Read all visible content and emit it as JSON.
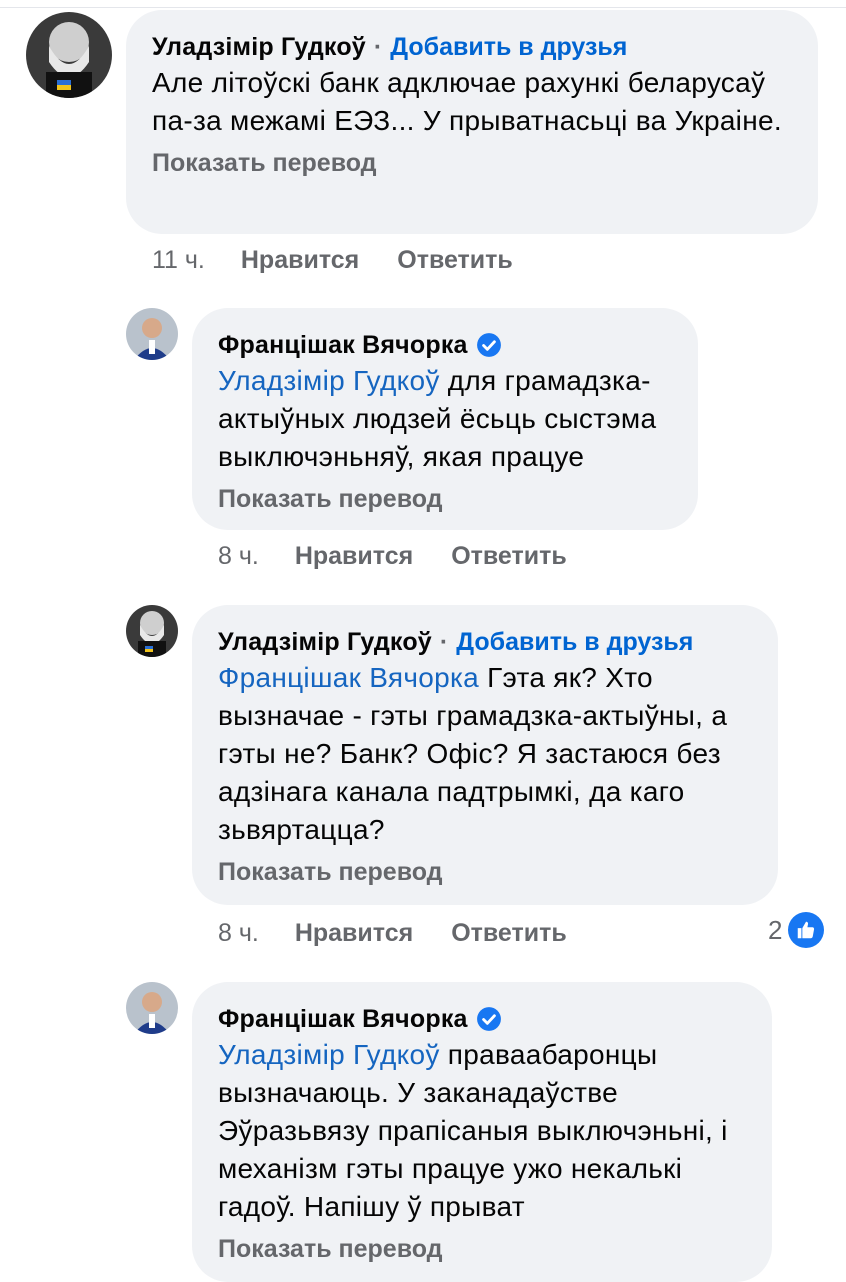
{
  "colors": {
    "bubble_bg": "#f0f2f5",
    "link_blue": "#0064d1",
    "mention_blue": "#1565c0",
    "meta_gray": "#65676b",
    "like_blue": "#1877f2"
  },
  "comments": [
    {
      "author": "Уладзімір Гудкоў",
      "separator": "·",
      "add_friend": "Добавить в друзья",
      "mention": "",
      "text": "Але літоўскі банк адключае рахункі беларусаў па-за межамі ЕЭЗ... У прыватнасьці ва Украіне.",
      "show_translation": "Показать перевод",
      "time": "11 ч.",
      "like": "Нравится",
      "reply": "Ответить"
    },
    {
      "author": "Францішак Вячорка",
      "verified_icon": "verified-badge-icon",
      "mention": "Уладзімір Гудкоў",
      "text": " для грамадзка-актыўных людзей ёсьць сыстэма выключэньняў, якая працуе",
      "show_translation": "Показать перевод",
      "time": "8 ч.",
      "like": "Нравится",
      "reply": "Ответить"
    },
    {
      "author": "Уладзімір Гудкоў",
      "separator": "·",
      "add_friend": "Добавить в друзья",
      "mention": "Францішак Вячорка",
      "text": " Гэта як? Хто вызначае - гэты грамадзка-актыўны, а гэты не? Банк? Офіс? Я застаюся без адзінага канала падтрымкі, да каго зьвяртацца?",
      "show_translation": "Показать перевод",
      "time": "8 ч.",
      "like": "Нравится",
      "reply": "Ответить",
      "reaction_count": "2",
      "reaction_icon": "like-reaction-icon"
    },
    {
      "author": "Францішак Вячорка",
      "verified_icon": "verified-badge-icon",
      "mention": "Уладзімір Гудкоў",
      "text": " праваабаронцы вызначаюць.  У заканадаўстве Эўразьвязу прапісаныя выключэньні, і механізм гэты працуе ужо некалькі гадоў. Напішу ў прыват",
      "show_translation": "Показать перевод"
    }
  ]
}
